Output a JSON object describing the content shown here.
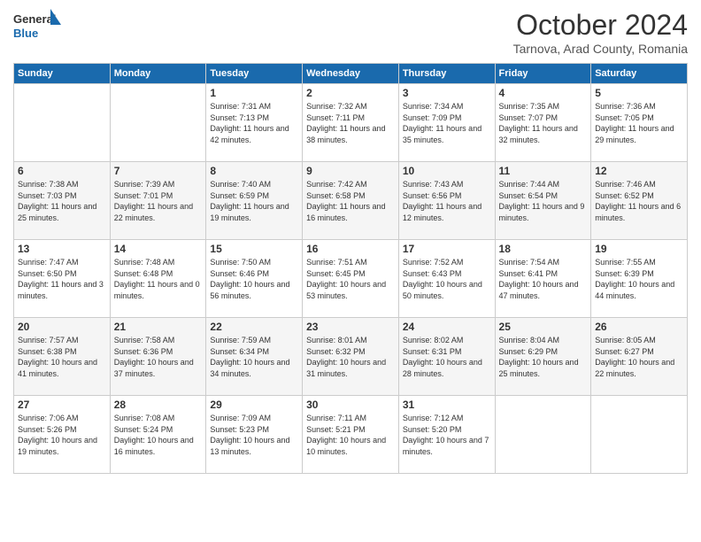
{
  "logo": {
    "general": "General",
    "blue": "Blue"
  },
  "header": {
    "month": "October 2024",
    "location": "Tarnova, Arad County, Romania"
  },
  "days_of_week": [
    "Sunday",
    "Monday",
    "Tuesday",
    "Wednesday",
    "Thursday",
    "Friday",
    "Saturday"
  ],
  "weeks": [
    [
      {
        "day": "",
        "info": ""
      },
      {
        "day": "",
        "info": ""
      },
      {
        "day": "1",
        "info": "Sunrise: 7:31 AM\nSunset: 7:13 PM\nDaylight: 11 hours and 42 minutes."
      },
      {
        "day": "2",
        "info": "Sunrise: 7:32 AM\nSunset: 7:11 PM\nDaylight: 11 hours and 38 minutes."
      },
      {
        "day": "3",
        "info": "Sunrise: 7:34 AM\nSunset: 7:09 PM\nDaylight: 11 hours and 35 minutes."
      },
      {
        "day": "4",
        "info": "Sunrise: 7:35 AM\nSunset: 7:07 PM\nDaylight: 11 hours and 32 minutes."
      },
      {
        "day": "5",
        "info": "Sunrise: 7:36 AM\nSunset: 7:05 PM\nDaylight: 11 hours and 29 minutes."
      }
    ],
    [
      {
        "day": "6",
        "info": "Sunrise: 7:38 AM\nSunset: 7:03 PM\nDaylight: 11 hours and 25 minutes."
      },
      {
        "day": "7",
        "info": "Sunrise: 7:39 AM\nSunset: 7:01 PM\nDaylight: 11 hours and 22 minutes."
      },
      {
        "day": "8",
        "info": "Sunrise: 7:40 AM\nSunset: 6:59 PM\nDaylight: 11 hours and 19 minutes."
      },
      {
        "day": "9",
        "info": "Sunrise: 7:42 AM\nSunset: 6:58 PM\nDaylight: 11 hours and 16 minutes."
      },
      {
        "day": "10",
        "info": "Sunrise: 7:43 AM\nSunset: 6:56 PM\nDaylight: 11 hours and 12 minutes."
      },
      {
        "day": "11",
        "info": "Sunrise: 7:44 AM\nSunset: 6:54 PM\nDaylight: 11 hours and 9 minutes."
      },
      {
        "day": "12",
        "info": "Sunrise: 7:46 AM\nSunset: 6:52 PM\nDaylight: 11 hours and 6 minutes."
      }
    ],
    [
      {
        "day": "13",
        "info": "Sunrise: 7:47 AM\nSunset: 6:50 PM\nDaylight: 11 hours and 3 minutes."
      },
      {
        "day": "14",
        "info": "Sunrise: 7:48 AM\nSunset: 6:48 PM\nDaylight: 11 hours and 0 minutes."
      },
      {
        "day": "15",
        "info": "Sunrise: 7:50 AM\nSunset: 6:46 PM\nDaylight: 10 hours and 56 minutes."
      },
      {
        "day": "16",
        "info": "Sunrise: 7:51 AM\nSunset: 6:45 PM\nDaylight: 10 hours and 53 minutes."
      },
      {
        "day": "17",
        "info": "Sunrise: 7:52 AM\nSunset: 6:43 PM\nDaylight: 10 hours and 50 minutes."
      },
      {
        "day": "18",
        "info": "Sunrise: 7:54 AM\nSunset: 6:41 PM\nDaylight: 10 hours and 47 minutes."
      },
      {
        "day": "19",
        "info": "Sunrise: 7:55 AM\nSunset: 6:39 PM\nDaylight: 10 hours and 44 minutes."
      }
    ],
    [
      {
        "day": "20",
        "info": "Sunrise: 7:57 AM\nSunset: 6:38 PM\nDaylight: 10 hours and 41 minutes."
      },
      {
        "day": "21",
        "info": "Sunrise: 7:58 AM\nSunset: 6:36 PM\nDaylight: 10 hours and 37 minutes."
      },
      {
        "day": "22",
        "info": "Sunrise: 7:59 AM\nSunset: 6:34 PM\nDaylight: 10 hours and 34 minutes."
      },
      {
        "day": "23",
        "info": "Sunrise: 8:01 AM\nSunset: 6:32 PM\nDaylight: 10 hours and 31 minutes."
      },
      {
        "day": "24",
        "info": "Sunrise: 8:02 AM\nSunset: 6:31 PM\nDaylight: 10 hours and 28 minutes."
      },
      {
        "day": "25",
        "info": "Sunrise: 8:04 AM\nSunset: 6:29 PM\nDaylight: 10 hours and 25 minutes."
      },
      {
        "day": "26",
        "info": "Sunrise: 8:05 AM\nSunset: 6:27 PM\nDaylight: 10 hours and 22 minutes."
      }
    ],
    [
      {
        "day": "27",
        "info": "Sunrise: 7:06 AM\nSunset: 5:26 PM\nDaylight: 10 hours and 19 minutes."
      },
      {
        "day": "28",
        "info": "Sunrise: 7:08 AM\nSunset: 5:24 PM\nDaylight: 10 hours and 16 minutes."
      },
      {
        "day": "29",
        "info": "Sunrise: 7:09 AM\nSunset: 5:23 PM\nDaylight: 10 hours and 13 minutes."
      },
      {
        "day": "30",
        "info": "Sunrise: 7:11 AM\nSunset: 5:21 PM\nDaylight: 10 hours and 10 minutes."
      },
      {
        "day": "31",
        "info": "Sunrise: 7:12 AM\nSunset: 5:20 PM\nDaylight: 10 hours and 7 minutes."
      },
      {
        "day": "",
        "info": ""
      },
      {
        "day": "",
        "info": ""
      }
    ]
  ]
}
